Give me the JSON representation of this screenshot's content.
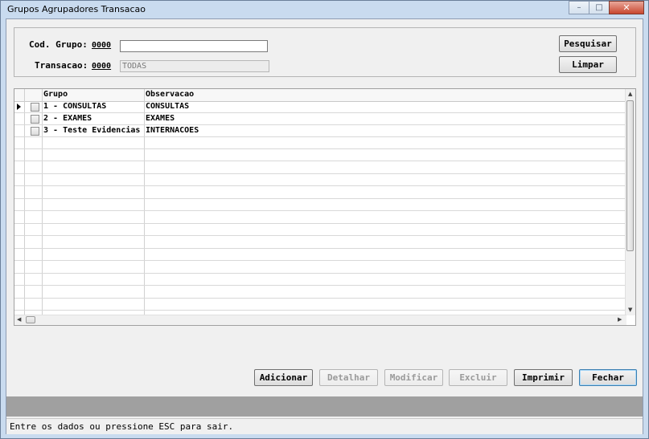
{
  "window": {
    "title": "Grupos Agrupadores Transacao",
    "controls": {
      "minimize": "–",
      "maximize": "□",
      "close": "✕"
    }
  },
  "filter": {
    "cod_grupo_label": "Cod. Grupo:",
    "cod_grupo_code": "0000",
    "cod_grupo_value": "",
    "transacao_label": "Transacao:",
    "transacao_code": "0000",
    "transacao_value": "TODAS",
    "pesquisar_label": "Pesquisar",
    "limpar_label": "Limpar"
  },
  "grid": {
    "columns": [
      "Grupo",
      "Observacao"
    ],
    "rows": [
      {
        "grupo": "1 - CONSULTAS",
        "observacao": "CONSULTAS"
      },
      {
        "grupo": "2 - EXAMES",
        "observacao": "EXAMES"
      },
      {
        "grupo": "3 - Teste Evidencias",
        "observacao": "INTERNACOES"
      }
    ]
  },
  "actions": {
    "adicionar": "Adicionar",
    "detalhar": "Detalhar",
    "modificar": "Modificar",
    "excluir": "Excluir",
    "imprimir": "Imprimir",
    "fechar": "Fechar"
  },
  "status": {
    "message": "Entre os dados ou pressione ESC para sair."
  }
}
